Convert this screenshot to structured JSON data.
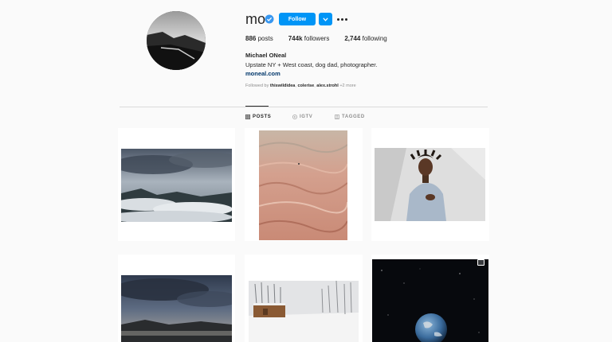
{
  "profile": {
    "username": "mo",
    "follow_label": "Follow",
    "stats": {
      "posts_count": "886",
      "posts_label": "posts",
      "followers_count": "744k",
      "followers_label": "followers",
      "following_count": "2,744",
      "following_label": "following"
    },
    "full_name": "Michael ONeal",
    "bio": "Upstate NY + West coast, dog dad, photographer.",
    "website": "moneal.com",
    "followed_by": {
      "prefix": "Followed by",
      "users": [
        "thiswildidea",
        "colerise",
        "alex.strohl"
      ],
      "more": "+2 more"
    }
  },
  "tabs": [
    {
      "label": "POSTS",
      "icon": "grid-icon",
      "active": true
    },
    {
      "label": "IGTV",
      "icon": "igtv-icon",
      "active": false
    },
    {
      "label": "TAGGED",
      "icon": "tag-icon",
      "active": false
    }
  ],
  "posts": [
    {
      "subject": "clouds-over-mountains"
    },
    {
      "subject": "pink-sandstone"
    },
    {
      "subject": "man-in-grey-sweater"
    },
    {
      "subject": "stormy-sky-over-lake"
    },
    {
      "subject": "snowy-road-cabin"
    },
    {
      "subject": "earth-in-space"
    }
  ],
  "colors": {
    "accent": "#0095f6",
    "background": "#fafafa",
    "link": "#00376b",
    "muted": "#8e8e8e"
  }
}
